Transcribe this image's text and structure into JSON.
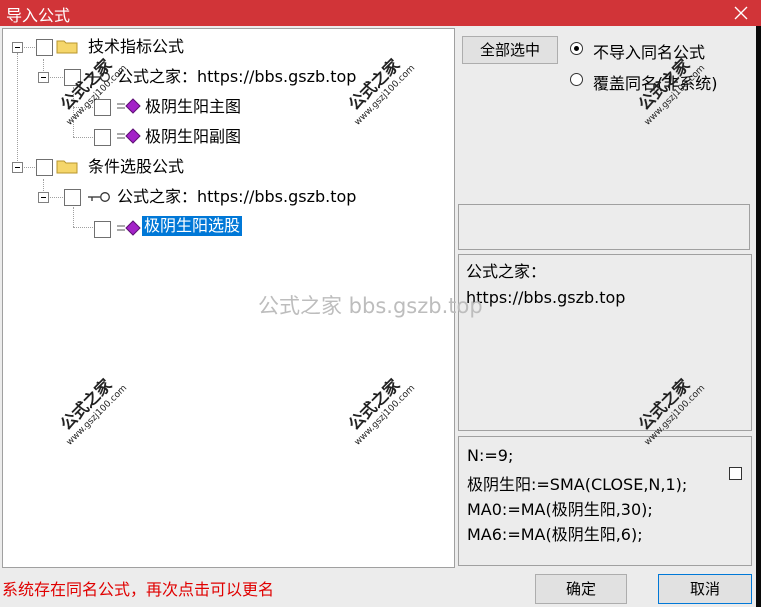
{
  "window": {
    "title": "导入公式",
    "colors": {
      "titlebar": "#d13438",
      "selection": "#0078d7",
      "status": "#e00000"
    }
  },
  "tree": {
    "nodes": [
      {
        "label": "技术指标公式",
        "icon": "folder-icon"
      },
      {
        "label": "公式之家：https://bbs.gszb.top",
        "icon": "key-icon"
      },
      {
        "label": "极阴生阳主图",
        "icon": "formula-icon"
      },
      {
        "label": "极阴生阳副图",
        "icon": "formula-icon"
      },
      {
        "label": "条件选股公式",
        "icon": "folder-icon"
      },
      {
        "label": "公式之家：https://bbs.gszb.top",
        "icon": "key-icon"
      },
      {
        "label": "极阴生阳选股",
        "icon": "formula-icon",
        "selected": true
      }
    ]
  },
  "controls": {
    "select_all": "全部选中",
    "options": [
      {
        "label": "不导入同名公式",
        "checked": true
      },
      {
        "label": "覆盖同名(非系统)",
        "checked": false
      }
    ]
  },
  "description": {
    "lines": [
      "公式之家：",
      "https://bbs.gszb.top"
    ]
  },
  "code": {
    "lines": [
      "N:=9;",
      "极阴生阳:=SMA(CLOSE,N,1);",
      "MA0:=MA(极阴生阳,30);",
      "MA6:=MA(极阴生阳,6);"
    ]
  },
  "status": "系统存在同名公式，再次点击可以更名",
  "buttons": {
    "ok": "确定",
    "cancel": "取消"
  },
  "watermarks": {
    "center": "公式之家 bbs.gszb.top",
    "stamp_title": "公式之家",
    "stamp_url": "www.gszj100.com"
  }
}
